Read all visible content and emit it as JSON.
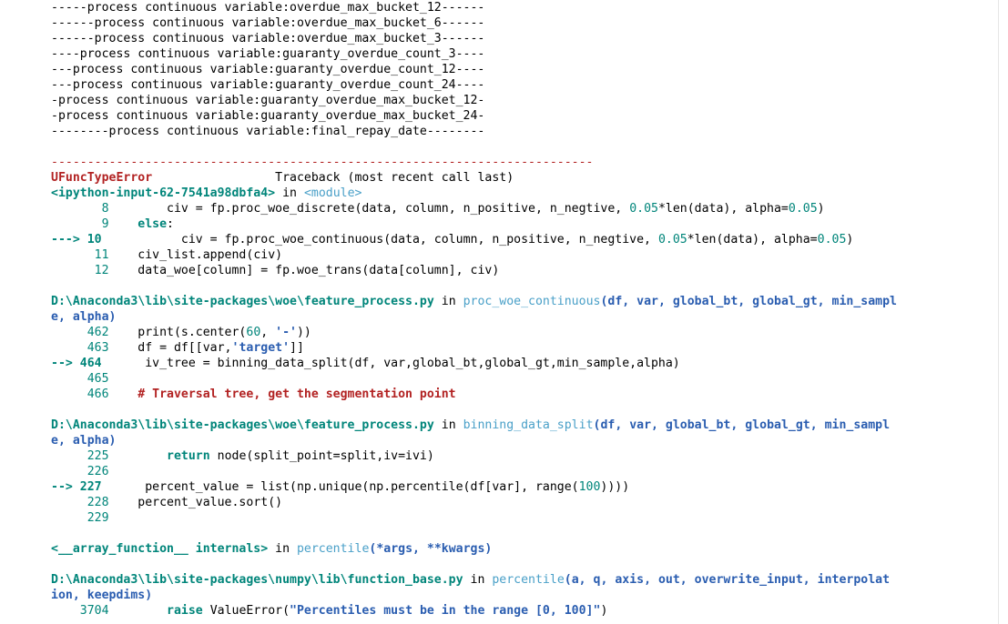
{
  "log_lines": [
    "-----process continuous variable:overdue_max_bucket_12------",
    "------process continuous variable:overdue_max_bucket_6------",
    "------process continuous variable:overdue_max_bucket_3------",
    "----process continuous variable:guaranty_overdue_count_3----",
    "---process continuous variable:guaranty_overdue_count_12----",
    "---process continuous variable:guaranty_overdue_count_24----",
    "-process continuous variable:guaranty_overdue_max_bucket_12-",
    "-process continuous variable:guaranty_overdue_max_bucket_24-",
    "--------process continuous variable:final_repay_date--------"
  ],
  "separator": "---------------------------------------------------------------------------",
  "error": {
    "type": "UFuncTypeError",
    "traceback_label": "Traceback (most recent call last)"
  },
  "frame1": {
    "file": "<ipython-input-62-7541a98dbfa4>",
    "in": "in",
    "func": "<module>",
    "lines": [
      {
        "num": "8",
        "arrow": "",
        "indent": "    ",
        "code": "civ = fp.proc_woe_discrete(data, column, n_positive, n_negtive, 0.05*len(data), alpha=0.05)"
      },
      {
        "num": "9",
        "arrow": "",
        "indent": "",
        "code": "else:"
      },
      {
        "num": "10",
        "arrow": "---> ",
        "indent": "      ",
        "code": "civ = fp.proc_woe_continuous(data, column, n_positive, n_negtive, 0.05*len(data), alpha=0.05)"
      },
      {
        "num": "11",
        "arrow": "",
        "indent": "",
        "code": "civ_list.append(civ)"
      },
      {
        "num": "12",
        "arrow": "",
        "indent": "",
        "code": "data_woe[column] = fp.woe_trans(data[column], civ)"
      }
    ]
  },
  "frame2": {
    "file": "D:\\Anaconda3\\lib\\site-packages\\woe\\feature_process.py",
    "in": "in",
    "func": "proc_woe_continuous",
    "args_a": "(df, var, global_bt, global_gt, min_sampl",
    "args_b": "e, alpha)",
    "lines": [
      {
        "num": "462",
        "code": "print(s.center(60, '-'))"
      },
      {
        "num": "463",
        "code": "df = df[[var,'target']]"
      },
      {
        "num": "464",
        "arrow": "--> ",
        "code": " iv_tree = binning_data_split(df, var,global_bt,global_gt,min_sample,alpha)"
      },
      {
        "num": "465",
        "code": ""
      },
      {
        "num": "466",
        "code": "# Traversal tree, get the segmentation point"
      }
    ]
  },
  "frame3": {
    "file": "D:\\Anaconda3\\lib\\site-packages\\woe\\feature_process.py",
    "in": "in",
    "func": "binning_data_split",
    "args_a": "(df, var, global_bt, global_gt, min_sampl",
    "args_b": "e, alpha)",
    "lines": [
      {
        "num": "225",
        "code": "    return node(split_point=split,iv=ivi)"
      },
      {
        "num": "226",
        "code": ""
      },
      {
        "num": "227",
        "arrow": "--> ",
        "code": " percent_value = list(np.unique(np.percentile(df[var], range(100))))"
      },
      {
        "num": "228",
        "code": "percent_value.sort()"
      },
      {
        "num": "229",
        "code": ""
      }
    ]
  },
  "frame4": {
    "file": "<__array_function__ internals>",
    "in": "in",
    "func": "percentile",
    "args": "(*args, **kwargs)"
  },
  "frame5": {
    "file": "D:\\Anaconda3\\lib\\site-packages\\numpy\\lib\\function_base.py",
    "in": "in",
    "func": "percentile",
    "args_a": "(a, q, axis, out, overwrite_input, interpolat",
    "args_b": "ion, keepdims)",
    "lines": [
      {
        "num": "3704",
        "code": "    raise ValueError(\"Percentiles must be in the range [0, 100]\")"
      }
    ]
  }
}
